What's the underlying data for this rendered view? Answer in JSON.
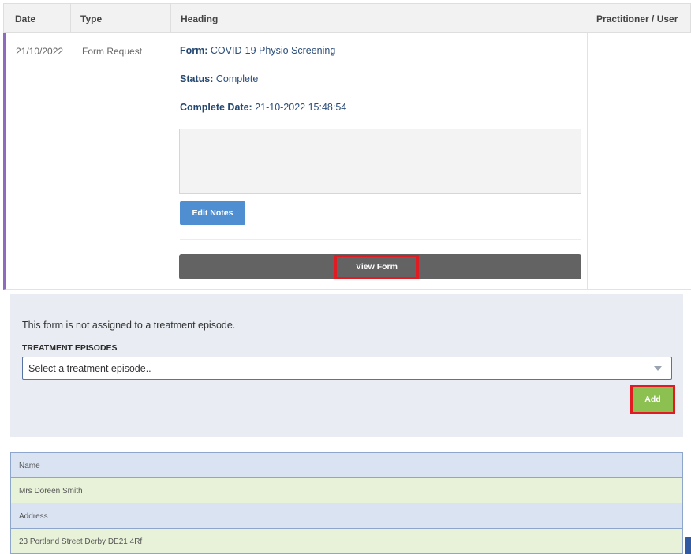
{
  "table": {
    "headers": {
      "date": "Date",
      "type": "Type",
      "heading": "Heading",
      "practitioner": "Practitioner / User"
    },
    "row": {
      "date": "21/10/2022",
      "type": "Form Request",
      "form_label": "Form:",
      "form_value": "COVID-19 Physio Screening",
      "status_label": "Status:",
      "status_value": "Complete",
      "complete_label": "Complete Date:",
      "complete_value": "21-10-2022 15:48:54",
      "notes": "",
      "edit_notes_label": "Edit Notes",
      "view_form_label": "View Form",
      "practitioner": ""
    }
  },
  "treatment": {
    "notice": "This form is not assigned to a treatment episode.",
    "label": "TREATMENT EPISODES",
    "placeholder": "Select a treatment episode..",
    "add_label": "Add"
  },
  "patient": {
    "name_label": "Name",
    "name_value": "Mrs Doreen Smith",
    "address_label": "Address",
    "address_value": "23 Portland Street Derby DE21 4Rf"
  },
  "colors": {
    "row_accent": "#8e6bbf",
    "edit_button": "#4f8ed0",
    "add_button": "#8cc152",
    "highlight_outline": "#e11b22"
  }
}
